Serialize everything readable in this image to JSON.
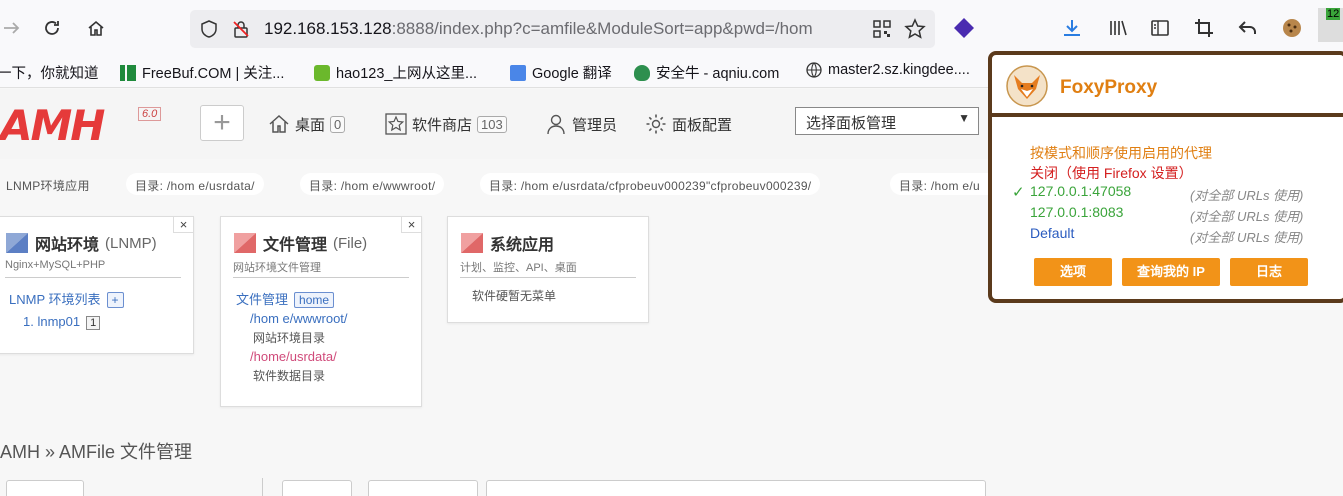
{
  "browser": {
    "url_host": "192.168.153.128",
    "url_rest": ":8888/index.php?c=amfile&ModuleSort=app&pwd=/hom",
    "ext_badge": "12"
  },
  "bookmarks": [
    {
      "label": "一下，你就知道"
    },
    {
      "label": "FreeBuf.COM | 关注..."
    },
    {
      "label": "hao123_上网从这里..."
    },
    {
      "label": "Google 翻译"
    },
    {
      "label": "安全牛 - aqniu.com"
    },
    {
      "label": "master2.sz.kingdee...."
    }
  ],
  "amh": {
    "logo": "AMH",
    "version": "6.0",
    "plus": "+",
    "nav": [
      {
        "label": "桌面",
        "count": "0"
      },
      {
        "label": "软件商店",
        "count": "103"
      },
      {
        "label": "管理员"
      },
      {
        "label": "面板配置"
      }
    ],
    "select_label": "选择面板管理",
    "select_arrow": "▼"
  },
  "tags": [
    "LNMP环境应用",
    "目录: /hom e/usrdata/",
    "目录: /hom e/wwwroot/",
    "目录: /hom e/usrdata/cfprobeuv000239\"cfprobeuv000239/",
    "目录: /hom e/u"
  ],
  "cards": {
    "lnmp": {
      "title": "网站环境",
      "title_en": "(LNMP)",
      "sub": "Nginx+MySQL+PHP",
      "list_label": "LNMP 环境列表",
      "add": "+",
      "item": "1. lnmp01",
      "item_count": "1",
      "close": "×"
    },
    "file": {
      "title": "文件管理",
      "title_en": "(File)",
      "sub": "网站环境文件管理",
      "link": "文件管理",
      "home": "home",
      "path1": "/hom e/wwwroot/",
      "path1_desc": "网站环境目录",
      "path2": "/home/usrdata/",
      "path2_desc": "软件数据目录",
      "close": "×"
    },
    "sys": {
      "title": "系统应用",
      "sub": "计划、监控、API、桌面",
      "empty": "软件硬暂无菜单"
    }
  },
  "breadcrumb": "AMH » AMFile 文件管理",
  "foxy": {
    "title": "FoxyProxy",
    "mode": "按模式和顺序使用启用的代理",
    "off": "关闭（使用 Firefox 设置）",
    "check": "✓",
    "proxies": [
      {
        "label": "127.0.0.1:47058",
        "note": "(对全部 URLs 使用)"
      },
      {
        "label": "127.0.0.1:8083",
        "note": "(对全部 URLs 使用)"
      },
      {
        "label": "Default",
        "note": "(对全部 URLs 使用)"
      }
    ],
    "buttons": [
      "选项",
      "查询我的 IP",
      "日志"
    ]
  }
}
